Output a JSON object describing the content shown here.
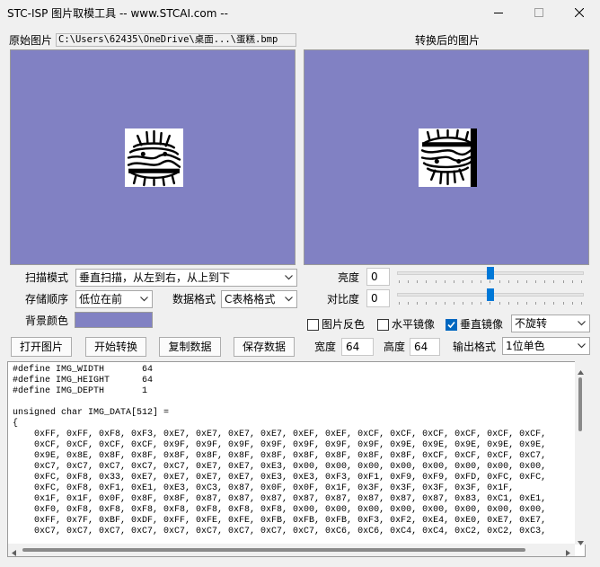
{
  "window": {
    "title": "STC-ISP 图片取模工具 -- www.STCAI.com --",
    "controls": [
      "minimize-icon",
      "maximize-icon",
      "close-icon"
    ]
  },
  "left_panel": {
    "label": "原始图片",
    "path": "C:\\Users\\62435\\OneDrive\\桌面...\\蛋糕.bmp"
  },
  "right_panel": {
    "label": "转换后的图片"
  },
  "settings": {
    "scan_mode_label": "扫描模式",
    "scan_mode_value": "垂直扫描，从左到右，从上到下",
    "storage_order_label": "存储顺序",
    "storage_order_value": "低位在前",
    "data_format_label": "数据格式",
    "data_format_value": "C表格格式",
    "bg_color_label": "背景颜色",
    "bg_color": "#8181c3",
    "brightness_label": "亮度",
    "brightness_value": "0",
    "brightness_level": 0.5,
    "contrast_label": "对比度",
    "contrast_value": "0",
    "contrast_level": 0.5,
    "invert_label": "图片反色",
    "invert_checked": false,
    "hmirror_label": "水平镜像",
    "hmirror_checked": false,
    "vmirror_label": "垂直镜像",
    "vmirror_checked": true,
    "rotation_value": "不旋转",
    "width_label": "宽度",
    "width_value": "64",
    "height_label": "高度",
    "height_value": "64",
    "output_format_label": "输出格式",
    "output_format_value": "1位单色"
  },
  "buttons": {
    "open": "打开图片",
    "convert": "开始转换",
    "copy": "复制数据",
    "save": "保存数据"
  },
  "code": {
    "lines": [
      "#define IMG_WIDTH       64",
      "#define IMG_HEIGHT      64",
      "#define IMG_DEPTH       1",
      "",
      "unsigned char IMG_DATA[512] =",
      "{",
      "    0xFF, 0xFF, 0xF8, 0xF3, 0xE7, 0xE7, 0xE7, 0xE7, 0xEF, 0xEF, 0xCF, 0xCF, 0xCF, 0xCF, 0xCF, 0xCF,",
      "    0xCF, 0xCF, 0xCF, 0xCF, 0x9F, 0x9F, 0x9F, 0x9F, 0x9F, 0x9F, 0x9F, 0x9E, 0x9E, 0x9E, 0x9E, 0x9E,",
      "    0x9E, 0x8E, 0x8F, 0x8F, 0x8F, 0x8F, 0x8F, 0x8F, 0x8F, 0x8F, 0x8F, 0x8F, 0xCF, 0xCF, 0xCF, 0xC7,",
      "    0xC7, 0xC7, 0xC7, 0xC7, 0xC7, 0xE7, 0xE7, 0xE3, 0x00, 0x00, 0x00, 0x00, 0x00, 0x00, 0x00, 0x00,",
      "    0xFC, 0xF8, 0x33, 0xE7, 0xE7, 0xE7, 0xE7, 0xE3, 0xE3, 0xF3, 0xF1, 0xF9, 0xF9, 0xFD, 0xFC, 0xFC,",
      "    0xFC, 0xF8, 0xF1, 0xE1, 0xE3, 0xC3, 0x87, 0x0F, 0x0F, 0x1F, 0x3F, 0x3F, 0x3F, 0x3F, 0x1F,",
      "    0x1F, 0x1F, 0x0F, 0x8F, 0x8F, 0x87, 0x87, 0x87, 0x87, 0x87, 0x87, 0x87, 0x87, 0x83, 0xC1, 0xE1,",
      "    0xF0, 0xF8, 0xF8, 0xF8, 0xF8, 0xF8, 0xF8, 0xF8, 0x00, 0x00, 0x00, 0x00, 0x00, 0x00, 0x00, 0x00,",
      "    0xFF, 0x7F, 0xBF, 0xDF, 0xFF, 0xFE, 0xFE, 0xFB, 0xFB, 0xFB, 0xF3, 0xF2, 0xE4, 0xE0, 0xE7, 0xE7,",
      "    0xC7, 0xC7, 0xC7, 0xC7, 0xC7, 0xC7, 0xC7, 0xC7, 0xC7, 0xC6, 0xC6, 0xC4, 0xC4, 0xC2, 0xC2, 0xC3,"
    ]
  }
}
